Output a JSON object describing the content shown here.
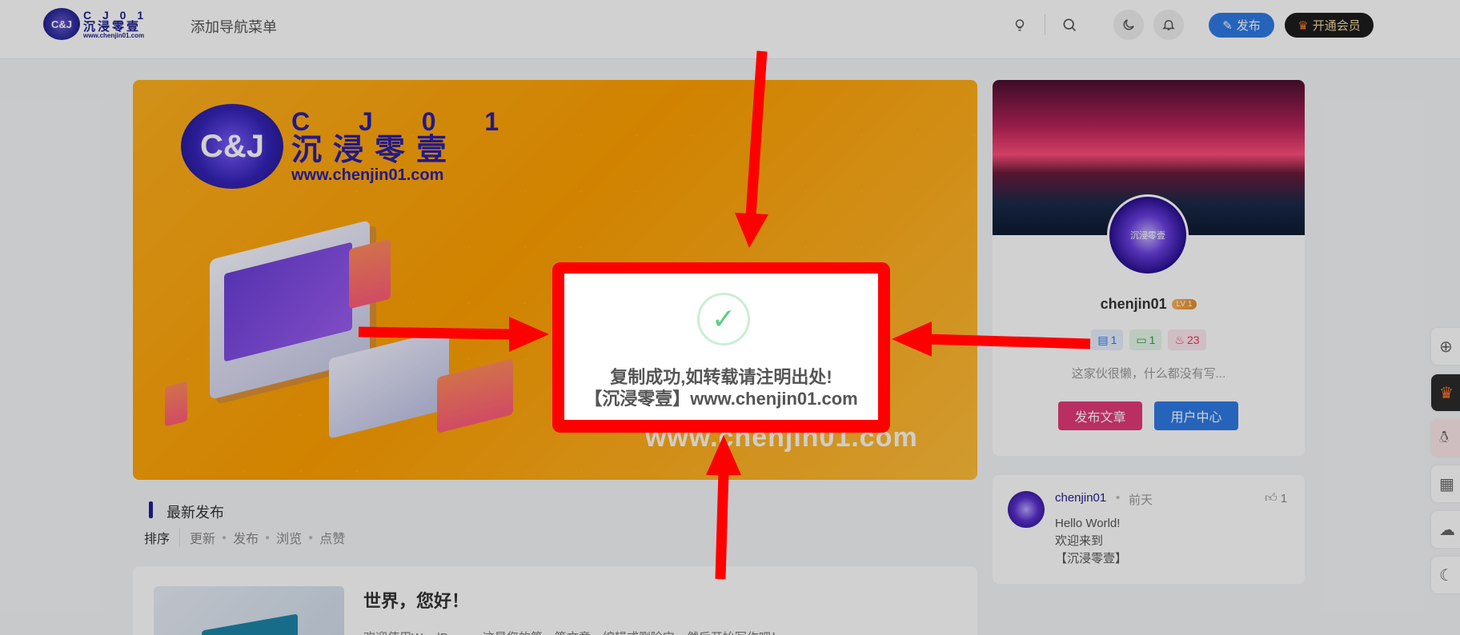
{
  "header": {
    "logo": {
      "line1": "C J 0 1",
      "line2": "沉浸零壹",
      "line3": "www.chenjin01.com"
    },
    "nav_add": "添加导航菜单",
    "publish_label": "发布",
    "vip_label": "开通会员"
  },
  "banner": {
    "logo_line1": "C J 0 1",
    "logo_line2": "沉浸零壹",
    "logo_line3": "www.chenjin01.com",
    "url": "www.chenjin01.com"
  },
  "latest": {
    "title": "最新发布",
    "sort_label": "排序",
    "sort_options": [
      "更新",
      "发布",
      "浏览",
      "点赞"
    ]
  },
  "post": {
    "title": "世界，您好！",
    "excerpt": "欢迎使用WordPress。这是您的第一篇文章。编辑或删除它，然后开始写作吧！"
  },
  "user": {
    "name": "chenjin01",
    "level": "LV 1",
    "posts_count": "1",
    "comments_count": "1",
    "hot_count": "23",
    "bio": "这家伙很懒，什么都没有写...",
    "btn_post": "发布文章",
    "btn_center": "用户中心"
  },
  "comment": {
    "user": "chenjin01",
    "time": "前天",
    "likes": "1",
    "line1": "Hello World!",
    "line2": "欢迎来到",
    "line3": "【沉浸零壹】"
  },
  "toast": {
    "line1": "复制成功,如转载请注明出处!",
    "line2": "【沉浸零壹】www.chenjin01.com"
  },
  "colors": {
    "accent_blue": "#2f7ae5",
    "accent_pink": "#e23a78",
    "annotation_red": "#ff0000",
    "success_green": "#5bd083"
  }
}
